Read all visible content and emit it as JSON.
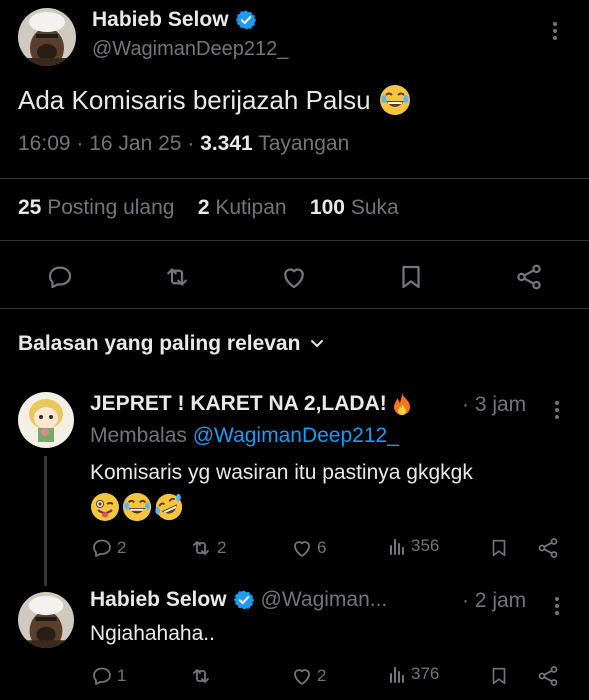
{
  "main_tweet": {
    "author_name": "Habieb Selow",
    "author_handle": "@WagimanDeep212_",
    "text": "Ada Komisaris berijazah Palsu",
    "time": "16:09",
    "date": "16 Jan 25",
    "views_count": "3.341",
    "views_label": "Tayangan",
    "reposts_count": "25",
    "reposts_label": "Posting ulang",
    "quotes_count": "2",
    "quotes_label": "Kutipan",
    "likes_count": "100",
    "likes_label": "Suka"
  },
  "replies_header": "Balasan yang paling relevan",
  "replies": [
    {
      "author_name": "JEPRET ! KARET NA 2,LADA!",
      "time": "· 3 jam",
      "replying_prefix": "Membalas",
      "replying_handle": "@WagimanDeep212_",
      "text": "Komisaris yg wasiran itu pastinya gkgkgk",
      "reply_count": "2",
      "repost_count": "2",
      "like_count": "6",
      "view_count": "356"
    },
    {
      "author_name": "Habieb Selow",
      "author_handle": "@Wagiman...",
      "time": "· 2 jam",
      "text": "Ngiahahaha..",
      "reply_count": "1",
      "repost_count": "",
      "like_count": "2",
      "view_count": "376"
    }
  ],
  "colors": {
    "background": "#000000",
    "text": "#e7e9ea",
    "muted": "#71767b",
    "link": "#1d9bf0",
    "verified": "#1d9bf0",
    "divider": "#2f3336"
  }
}
